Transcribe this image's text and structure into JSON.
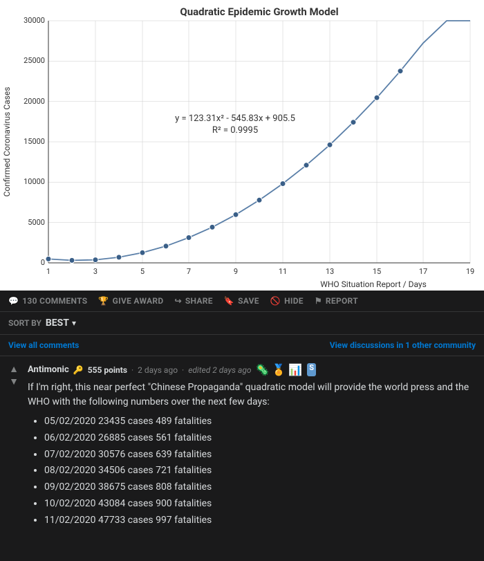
{
  "chart": {
    "title": "Quadratic Epidemic Growth Model",
    "formula": "y = 123.31x² - 545.83x + 905.5",
    "r_squared": "R² = 0.9995",
    "x_label": "WHO Situation Report / Days",
    "y_label": "Confirmed Coronavirus Cases",
    "y_ticks": [
      "0",
      "5000",
      "10000",
      "15000",
      "20000",
      "25000",
      "30000"
    ],
    "x_ticks": [
      "1",
      "3",
      "5",
      "7",
      "9",
      "11",
      "13",
      "15",
      "17",
      "19"
    ]
  },
  "actions": {
    "comments": "130 Comments",
    "give_award": "Give Award",
    "share": "Share",
    "save": "Save",
    "hide": "Hide",
    "report": "Report"
  },
  "sort": {
    "label": "SORT BY",
    "value": "BEST"
  },
  "links": {
    "view_all_comments": "View all comments",
    "view_discussions": "View discussions in 1 other community"
  },
  "comment": {
    "username": "Antimonic",
    "key_icon": "🔑",
    "points": "555 points",
    "separator": "·",
    "time": "2 days ago",
    "edited": "edited 2 days ago",
    "flair": [
      "🦠",
      "🏅",
      "📊",
      "S"
    ],
    "intro": "If I'm right, this near perfect \"Chinese Propaganda\" quadratic model will provide the world press and the WHO with the following numbers over the next few days:",
    "predictions": [
      "05/02/2020 23435 cases 489 fatalities",
      "06/02/2020 26885 cases 561 fatalities",
      "07/02/2020 30576 cases 639 fatalities",
      "08/02/2020 34506 cases 721 fatalities",
      "09/02/2020 38675 cases 808 fatalities",
      "10/02/2020 43084 cases 900 fatalities",
      "11/02/2020 47733 cases 997 fatalities"
    ]
  }
}
